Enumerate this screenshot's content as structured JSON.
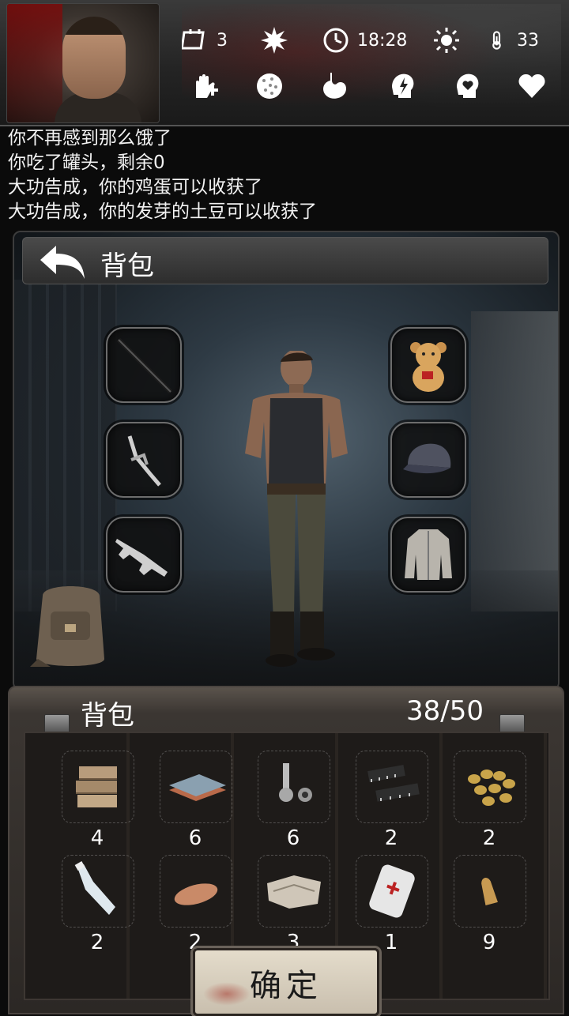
{
  "status": {
    "day": "3",
    "time": "18:28",
    "temperature": "33"
  },
  "log": [
    "你不再感到那么饿了",
    "你吃了罐头，剩余0",
    "大功告成，你的鸡蛋可以收获了",
    "大功告成，你的发芽的土豆可以收获了"
  ],
  "equipment": {
    "title": "背包",
    "left_slots": [
      "rifle-weapon",
      "crossbow-weapon",
      "submachine-gun"
    ],
    "right_slots": [
      "teddy-bear",
      "baseball-cap",
      "winter-jacket"
    ]
  },
  "inventory": {
    "title": "背包",
    "capacity": "38/50",
    "items": [
      {
        "icon": "wood-planks-icon",
        "qty": "4"
      },
      {
        "icon": "metal-sheets-icon",
        "qty": "6"
      },
      {
        "icon": "bolts-icon",
        "qty": "6"
      },
      {
        "icon": "microchips-icon",
        "qty": "2"
      },
      {
        "icon": "coffee-beans-icon",
        "qty": "2"
      },
      {
        "icon": "glass-bottle-icon",
        "qty": "2"
      },
      {
        "icon": "sweet-potato-icon",
        "qty": "2"
      },
      {
        "icon": "cloth-icon",
        "qty": "3"
      },
      {
        "icon": "flask-icon",
        "qty": "1"
      },
      {
        "icon": "bullet-icon",
        "qty": "9"
      }
    ]
  },
  "confirm": "确定",
  "colors": {
    "accent_blood": "#8a1010",
    "panel": "#2c2825"
  }
}
